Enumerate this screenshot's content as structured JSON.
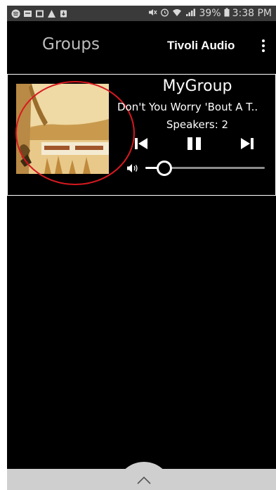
{
  "status_bar": {
    "battery": "39%",
    "time": "3:38 PM"
  },
  "app_bar": {
    "title": "Groups",
    "brand": "Tivoli Audio",
    "menu_icon": "more-vert-icon"
  },
  "group": {
    "name": "MyGroup",
    "track": "Don't You Worry 'Bout A T..",
    "speakers_label": "Speakers:",
    "speakers_count": "2",
    "speakers_text": "Speakers:  2",
    "volume_level": 0.16,
    "controls": [
      "previous-icon",
      "pause-icon",
      "next-icon"
    ]
  },
  "colors": {
    "background": "#000000",
    "highlight": "#d71920",
    "status_bar": "#3a3a3a",
    "bottom_bar": "#cfcfcf"
  }
}
